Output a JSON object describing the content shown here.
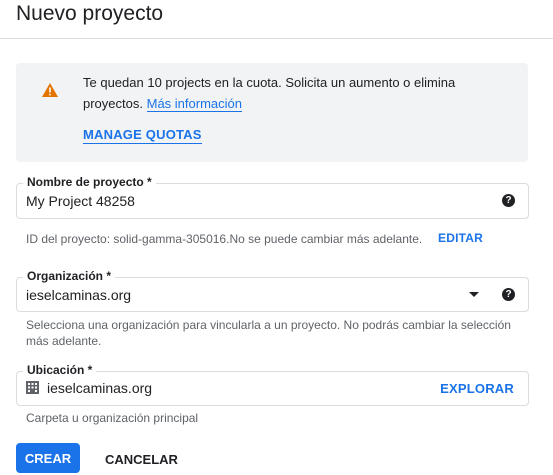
{
  "page": {
    "title": "Nuevo proyecto"
  },
  "quota": {
    "message": "Te quedan 10 projects en la cuota. Solicita un aumento o elimina proyectos.",
    "link": "Más información",
    "manage_label": "MANAGE QUOTAS",
    "icon": "warning-icon",
    "warning_color": "#e37400"
  },
  "project_name": {
    "label": "Nombre de proyecto *",
    "value": "My Project 48258",
    "project_id_hint": "ID del proyecto: solid-gamma-305016.No se puede cambiar más adelante.",
    "edit_label": "EDITAR"
  },
  "organization": {
    "label": "Organización *",
    "value": "ieselcaminas.org",
    "hint": "Selecciona una organización para vincularla a un proyecto. No podrás cambiar la selección más adelante."
  },
  "location": {
    "label": "Ubicación *",
    "value": "ieselcaminas.org",
    "explore_label": "EXPLORAR",
    "hint": "Carpeta u organización principal"
  },
  "actions": {
    "create_label": "CREAR",
    "cancel_label": "CANCELAR"
  },
  "colors": {
    "accent": "#1a73e8",
    "quota_bg": "#f1f3f4"
  }
}
